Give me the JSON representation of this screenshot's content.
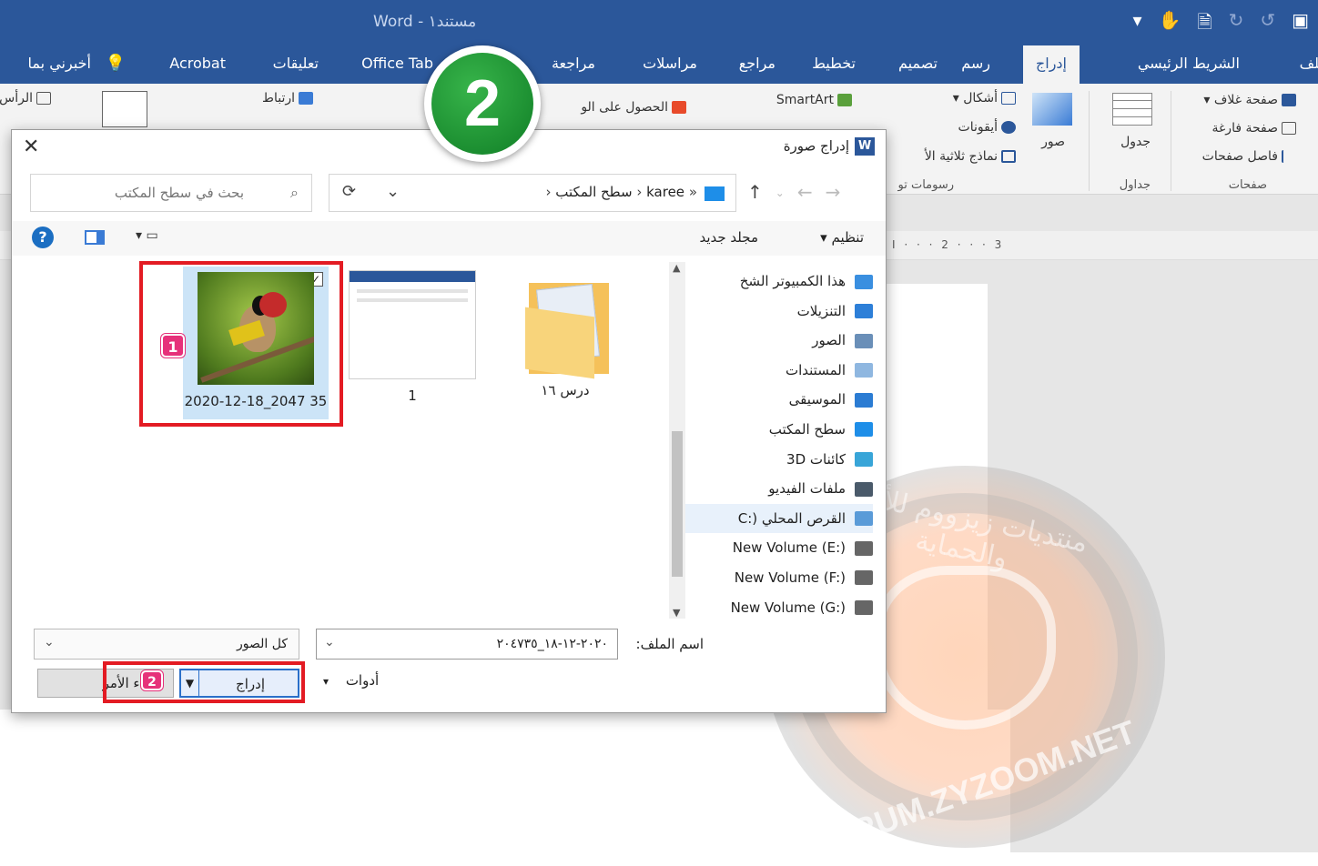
{
  "window": {
    "title": "Word  -  مستند١"
  },
  "ribbon_tabs": [
    {
      "label": "ملف"
    },
    {
      "label": "الشريط الرئيسي"
    },
    {
      "label": "إدراج"
    },
    {
      "label": "رسم"
    },
    {
      "label": "تصميم"
    },
    {
      "label": "تخطيط"
    },
    {
      "label": "مراجع"
    },
    {
      "label": "مراسلات"
    },
    {
      "label": "مراجعة"
    },
    {
      "label": "Office Tab"
    },
    {
      "label": "تعليقات"
    },
    {
      "label": "Acrobat"
    },
    {
      "label": "أخبرني بما"
    }
  ],
  "ribbon": {
    "pages": [
      "صفحة غلاف",
      "صفحة فارغة",
      "فاصل صفحات"
    ],
    "pages_group": "صفحات",
    "table": "جدول",
    "tables_group": "جداول",
    "pictures": "صور",
    "shapes": "أشكال",
    "icons": "أيقونات",
    "models": "نماذج ثلاثية الأ",
    "smartart": "SmartArt",
    "illustrations_group": "رسومات تو",
    "getaddins": "الحصول على الو",
    "link": "ارتباط",
    "header": "الرأس"
  },
  "ruler": "I · · · 2 · · · 3",
  "step_marker": "2",
  "dialog": {
    "title": "إدراج صورة",
    "address": {
      "path": [
        "karee",
        "سطح المكتب"
      ]
    },
    "search_placeholder": "بحث في سطح المكتب",
    "organize": "تنظيم",
    "new_folder": "مجلد جديد",
    "help": "?",
    "nav_items": [
      {
        "label": "هذا الكمبيوتر الشخ",
        "icon": "pc-icon",
        "color": "#3a8fe0"
      },
      {
        "label": "التنزيلات",
        "icon": "download-icon",
        "color": "#2d7fd8"
      },
      {
        "label": "الصور",
        "icon": "pictures-icon",
        "color": "#6a8fb8"
      },
      {
        "label": "المستندات",
        "icon": "documents-icon",
        "color": "#8fb7e0"
      },
      {
        "label": "الموسيقى",
        "icon": "music-icon",
        "color": "#2b7cd3"
      },
      {
        "label": "سطح المكتب",
        "icon": "desktop-icon",
        "color": "#1e8ee8"
      },
      {
        "label": "كائنات 3D",
        "icon": "3d-objects-icon",
        "color": "#38a5d8"
      },
      {
        "label": "ملفات الفيديو",
        "icon": "video-icon",
        "color": "#4a5a6a"
      },
      {
        "label": "القرص المحلي (:C",
        "icon": "drive-icon",
        "color": "#5a9bd8"
      },
      {
        "label": "New Volume (E:)",
        "icon": "drive-icon",
        "color": "#666666"
      },
      {
        "label": "New Volume (F:)",
        "icon": "drive-icon",
        "color": "#666666"
      },
      {
        "label": "New Volume (G:)",
        "icon": "drive-icon",
        "color": "#666666"
      }
    ],
    "files": [
      {
        "label": "درس ١٦"
      },
      {
        "label": "1"
      },
      {
        "label": "2020-12-18_2047 35"
      }
    ],
    "badges": {
      "one": "1",
      "two": "2"
    },
    "filename_label": "اسم الملف:",
    "filename_value": "٢٠٢٠-١٢-١٨_٢٠٤٧٣٥",
    "filetype_value": "كل الصور",
    "tools_label": "أدوات",
    "insert_label": "إدراج",
    "cancel_label": "إلغاء الأمر"
  },
  "watermark": {
    "arabic": "منتديات زيزووم للأمن والحماية",
    "latin": "FORUM.ZYZOOM.NET"
  },
  "colors": {
    "word_blue": "#2b579a",
    "highlight_red": "#e31b23",
    "badge_pink": "#e6317a",
    "step_green": "#1f9a35"
  }
}
